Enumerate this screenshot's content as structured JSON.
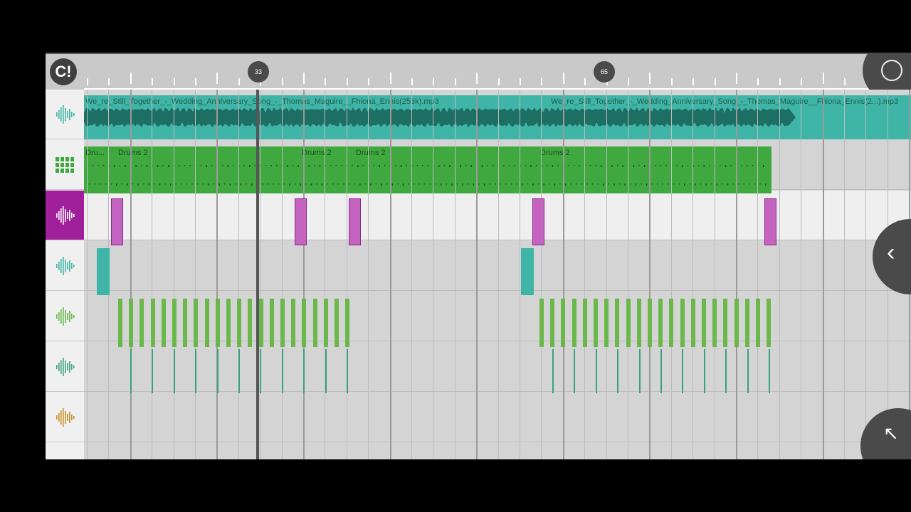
{
  "toolbar": {
    "logo": "C!"
  },
  "ruler": {
    "markers": [
      {
        "label": "33"
      },
      {
        "label": "65"
      }
    ]
  },
  "tracks": [
    {
      "name": "audio-track",
      "icon": "waveform-icon"
    },
    {
      "name": "pattern-track",
      "icon": "step-sequencer-icon"
    },
    {
      "name": "sample-track-1",
      "icon": "waveform-icon"
    },
    {
      "name": "sample-track-2",
      "icon": "waveform-icon"
    },
    {
      "name": "sample-track-3",
      "icon": "waveform-icon"
    },
    {
      "name": "sample-track-4",
      "icon": "waveform-icon"
    },
    {
      "name": "sample-track-5",
      "icon": "waveform-icon"
    }
  ],
  "clips": {
    "audio_1": "We_re_Still_Together_-_Wedding_Anniversary_Song_-_Thomas_Maguire__Fhiona_Ennis(256k).mp3",
    "audio_2": "We_re_Still_Together_-_Wedding_Anniversary_Song_-_Thomas_Maguire__Fhiona_Ennis(2...).mp3",
    "drums_short": "Dru...",
    "drums_a": "Drums 2",
    "drums_b": "Drums 2",
    "drums_c": "Drums 2",
    "drums_d": "Drums 2"
  },
  "colors": {
    "selected_track": "#a01f9b",
    "audio_clip": "#3fb5a8",
    "pattern_clip": "#3fa93f",
    "sample_magenta": "#c463c0",
    "sample_teal": "#3fb5a8",
    "sample_green": "#6ab84a",
    "sample_orange": "#c8902a"
  },
  "nav": {
    "collapse": "‹",
    "expand": "↖"
  }
}
